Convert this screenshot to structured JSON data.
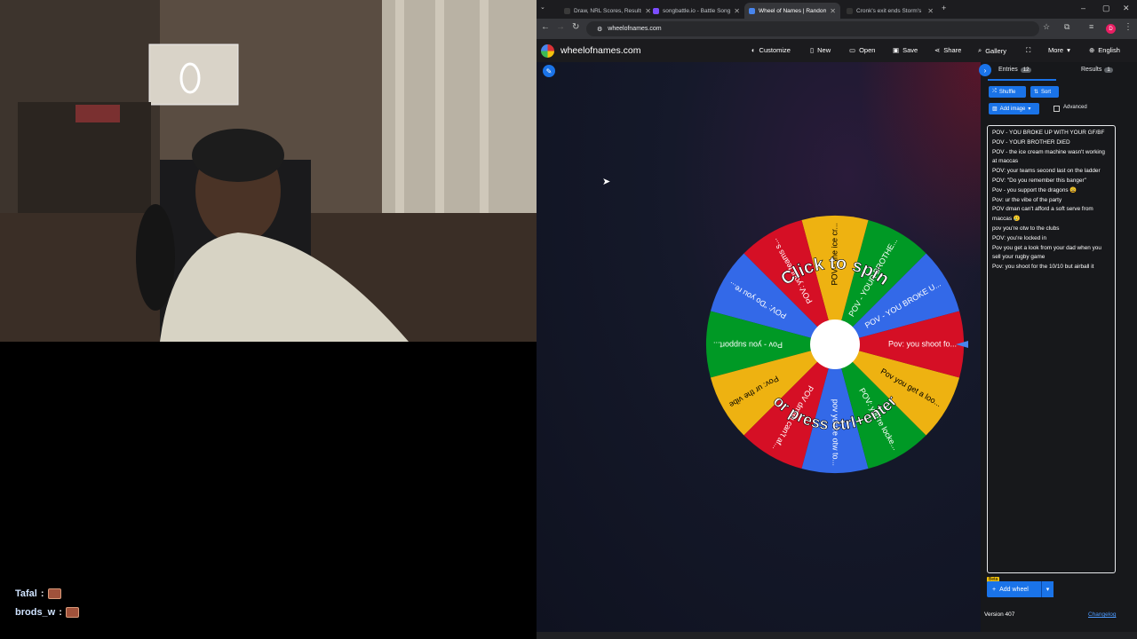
{
  "stream": {
    "chat": [
      {
        "user": "Tafal",
        "sep": ":"
      },
      {
        "user": "brods_w",
        "sep": ":"
      }
    ]
  },
  "browser": {
    "tabs": [
      {
        "label": "Draw, NRL Scores, Results",
        "color": "#3a3a3a"
      },
      {
        "label": "songbattle.io - Battle Songs",
        "color": "#7c4dff"
      },
      {
        "label": "Wheel of Names | Random",
        "color": "#4885ed"
      },
      {
        "label": "Cronk's exit ends Storm's",
        "color": "#333"
      }
    ],
    "new_tab": "+",
    "url": "wheelofnames.com",
    "profile_initial": "D"
  },
  "app": {
    "site_name": "wheelofnames.com",
    "menu": [
      {
        "label": "Customize",
        "icon": "palette-icon"
      },
      {
        "label": "New",
        "icon": "file-icon"
      },
      {
        "label": "Open",
        "icon": "folder-icon"
      },
      {
        "label": "Save",
        "icon": "save-icon"
      },
      {
        "label": "Share",
        "icon": "share-icon"
      },
      {
        "label": "Gallery",
        "icon": "search-icon"
      },
      {
        "label": "",
        "icon": "fullscreen-icon"
      },
      {
        "label": "More",
        "icon": "chevron-down-icon"
      },
      {
        "label": "English",
        "icon": "globe-icon"
      }
    ]
  },
  "wheel": {
    "cta_top": "Click to spin",
    "cta_bottom": "or press ctrl+enter",
    "colors": [
      "#3369e8",
      "#009925",
      "#eeb211",
      "#d50f25"
    ],
    "segments": [
      "POV - YOU BROKE U...",
      "POV - YOUR BROTHE...",
      "POV - the ice cr...",
      "POV: your teams s...",
      "POV: \"Do you re...",
      "Pov - you support...",
      "Pov: ur the vibe",
      "POV dman can't af...",
      "pov you're otw to...",
      "POV: you're locke...",
      "Pov you get a loo...",
      "Pov: you shoot fo..."
    ]
  },
  "panel": {
    "tab_entries": "Entries",
    "entries_count": "12",
    "tab_results": "Results",
    "results_count": "1",
    "shuffle": "Shuffle",
    "sort": "Sort",
    "add_image": "Add image",
    "advanced": "Advanced",
    "entries": [
      "POV - YOU BROKE UP WITH YOUR GF/BF",
      "POV - YOUR BROTHER DIED",
      "POV -  the ice cream machine wasn't working at maccas",
      "POV: your teams second last on the ladder",
      " POV: \"Do you remember this banger\"",
      "Pov - you support the dragons 😩",
      "Pov: ur the vibe of the party",
      "POV dman can't afford a soft serve from maccas 🥲",
      "pov you're otw to the clubs",
      "POV: you're locked in",
      "Pov you get a look from your dad when you sell your rugby game",
      "Pov: you shoot for the 10/10 but airball it"
    ],
    "beta": "Beta",
    "add_wheel": "Add wheel",
    "version": "Version 407",
    "changelog": "Changelog"
  }
}
